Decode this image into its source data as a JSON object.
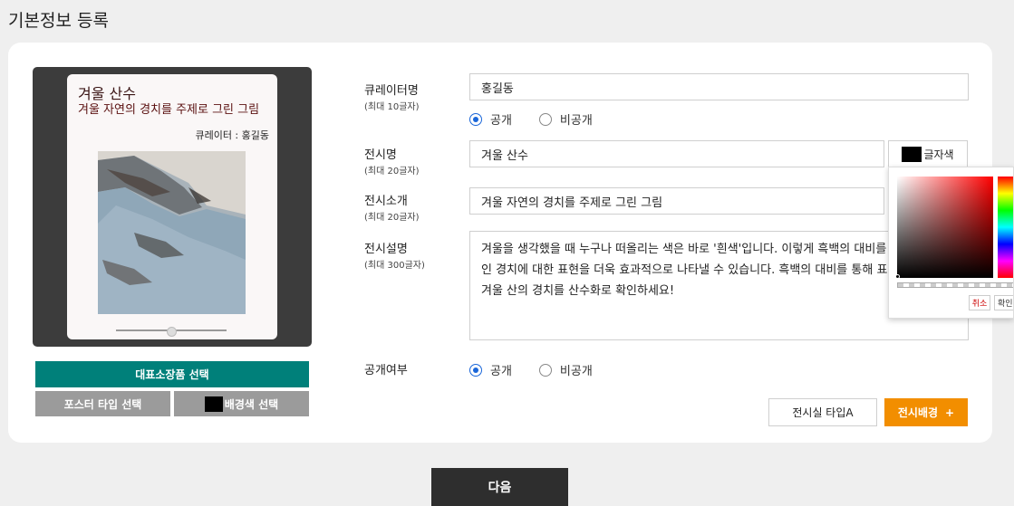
{
  "page_title": "기본정보 등록",
  "poster": {
    "title": "겨울 산수",
    "subtitle": "겨울 자연의 경치를 주제로 그린 그림",
    "curator_line": "큐레이터 : 홍길동"
  },
  "left_buttons": {
    "representative": "대표소장품 선택",
    "poster_type": "포스터 타입 선택",
    "bg_color": "배경색 선택"
  },
  "form": {
    "curator": {
      "label": "큐레이터명",
      "hint": "(최대 10글자)",
      "value": "홍길동"
    },
    "curator_visibility": {
      "public": "공개",
      "private": "비공개",
      "selected": "공개"
    },
    "exhibit_name": {
      "label": "전시명",
      "hint": "(최대 20글자)",
      "value": "겨울 산수"
    },
    "text_color_button": "글자색",
    "intro": {
      "label": "전시소개",
      "hint": "(최대 20글자)",
      "value": "겨울 자연의 경치를 주제로 그린 그림"
    },
    "description": {
      "label": "전시설명",
      "hint": "(최대 300글자)",
      "lines": [
        "겨울을 생각했을 때 누구나 떠올리는 색은 바로 '흰색'입니다. 이렇게 흑백의 대비를 ",
        "인 경치에 대한 표현을 더욱 효과적으로 나타낼 수 있습니다. 흑백의 대비를 통해 표현",
        "겨울 산의 경치를 산수화로 확인하세요!"
      ]
    },
    "visibility": {
      "label": "공개여부",
      "public": "공개",
      "private": "비공개",
      "selected": "공개"
    }
  },
  "color_picker": {
    "cancel": "취소",
    "ok": "확인"
  },
  "actions": {
    "room_type": "전시실 타입A",
    "bg_add": "전시배경",
    "bg_add_icon": "plus-icon",
    "next": "다음"
  },
  "colors": {
    "teal": "#00807a",
    "orange": "#f28e00",
    "dark": "#2e2e2e",
    "radio_blue": "#1a66d9"
  }
}
